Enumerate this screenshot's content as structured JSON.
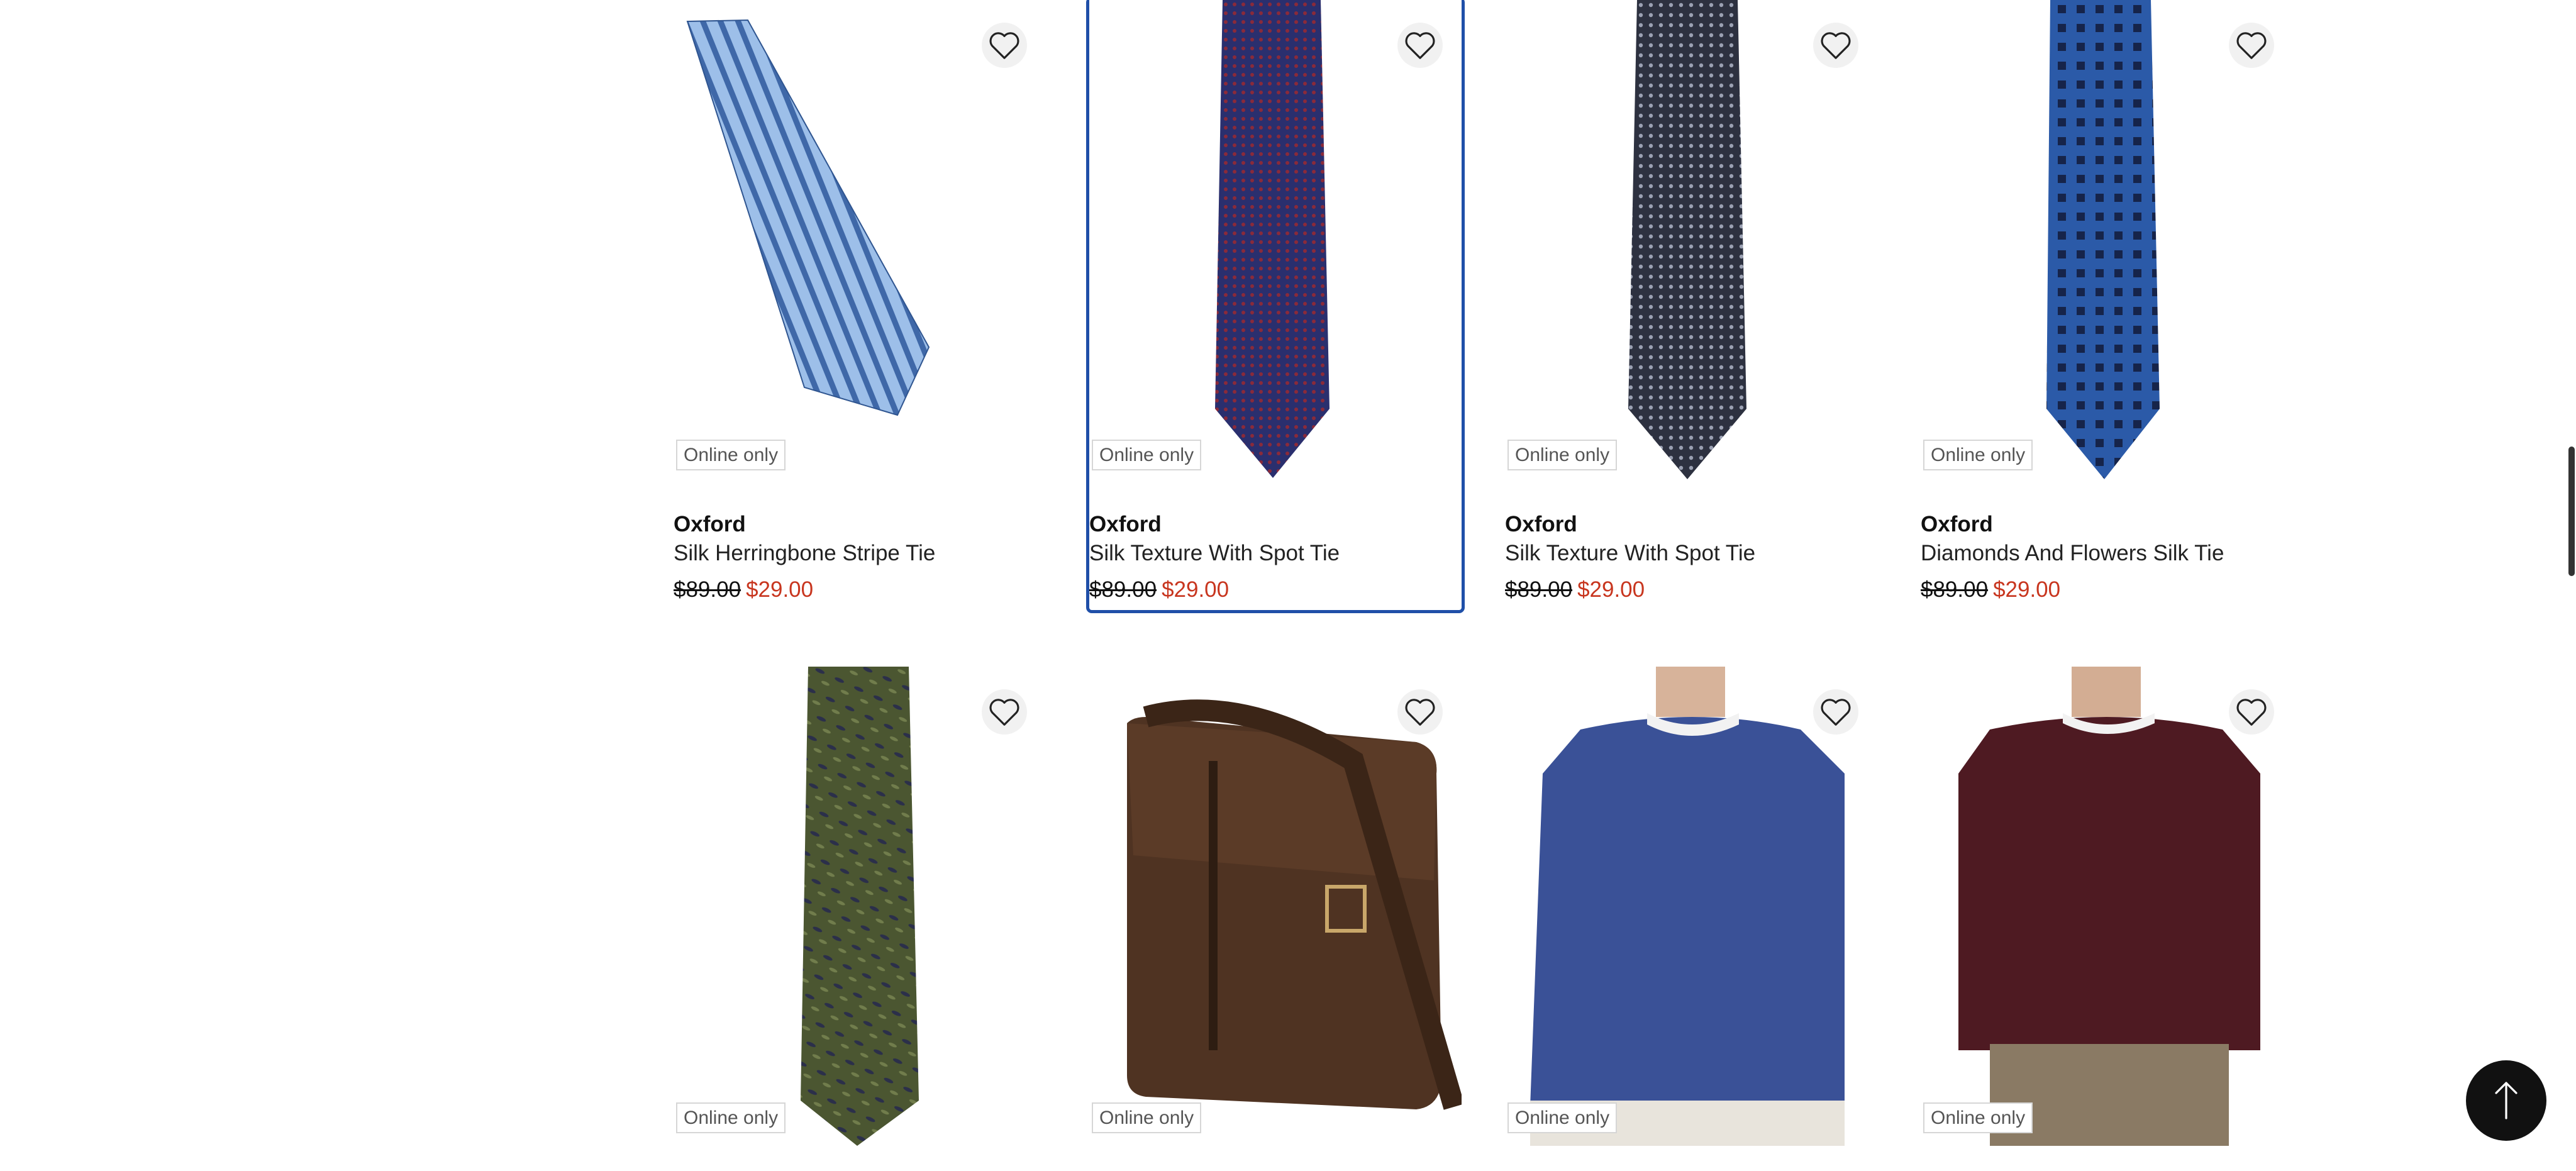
{
  "products": [
    {
      "badge": "Online only",
      "brand": "Oxford",
      "title": "Silk Herringbone Stripe Tie",
      "was": "$89.00",
      "now": "$29.00",
      "image": "striped-light-blue-tie"
    },
    {
      "badge": "Online only",
      "brand": "Oxford",
      "title": "Silk Texture With Spot Tie",
      "was": "$89.00",
      "now": "$29.00",
      "image": "navy-red-spot-tie"
    },
    {
      "badge": "Online only",
      "brand": "Oxford",
      "title": "Silk Texture With Spot Tie",
      "was": "$89.00",
      "now": "$29.00",
      "image": "charcoal-spot-tie"
    },
    {
      "badge": "Online only",
      "brand": "Oxford",
      "title": "Diamonds And Flowers Silk Tie",
      "was": "$89.00",
      "now": "$29.00",
      "image": "blue-diamonds-tie"
    },
    {
      "badge": "Online only",
      "image": "olive-leaf-tie"
    },
    {
      "badge": "Online only",
      "image": "brown-leather-messenger-bag"
    },
    {
      "badge": "Online only",
      "image": "blue-crew-neck-knit"
    },
    {
      "badge": "Online only",
      "image": "burgundy-crew-neck-knit"
    }
  ],
  "colors": {
    "sale_price": "#c8361f",
    "focus_outline": "#1f4fa8",
    "badge_border": "#d6d6d6"
  },
  "icons": {
    "wishlist": "heart-outline-icon",
    "back_to_top": "arrow-up-icon"
  }
}
